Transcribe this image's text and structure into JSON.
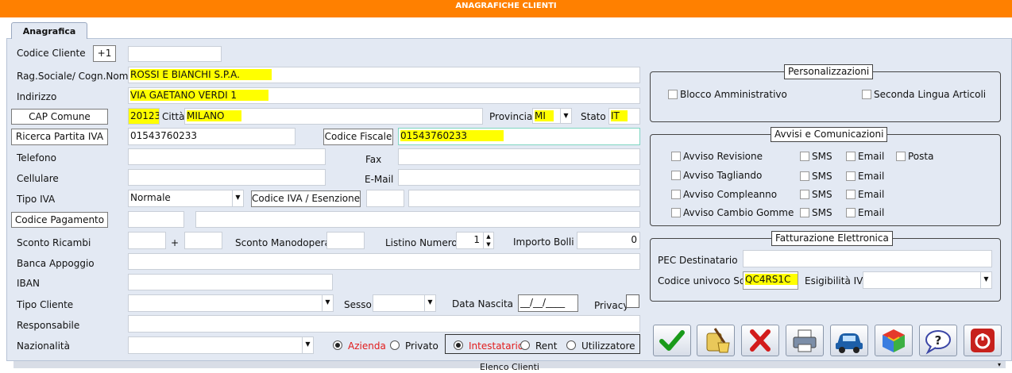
{
  "window": {
    "title": "ANAGRAFICHE CLIENTI"
  },
  "tab": {
    "label": "Anagrafica"
  },
  "left": {
    "codice_cliente_label": "Codice Cliente",
    "plus_button": "+1",
    "codice_cliente_value": "",
    "ragsociale_label": "Rag.Sociale/ Cogn.Nome",
    "ragsociale_value": "ROSSI E BIANCHI S.P.A.",
    "indirizzo_label": "Indirizzo",
    "indirizzo_value": "VIA GAETANO VERDI 1",
    "cap_button": "CAP Comune",
    "cap_value": "20123",
    "citta_label": "Città",
    "citta_value": "MILANO",
    "provincia_label": "Provincia",
    "provincia_value": "MI",
    "stato_label": "Stato",
    "stato_value": "IT",
    "piva_button": "Ricerca Partita IVA",
    "piva_value": "01543760233",
    "cf_button": "Codice Fiscale",
    "cf_value": "01543760233",
    "telefono_label": "Telefono",
    "fax_label": "Fax",
    "cellulare_label": "Cellulare",
    "email_label": "E-Mail",
    "tipoiva_label": "Tipo IVA",
    "tipoiva_value": "Normale",
    "codiva_button": "Codice IVA / Esenzione",
    "pagamento_button": "Codice Pagamento",
    "sconto_label": "Sconto Ricambi",
    "plus_sign": "+",
    "sconto_mano_label": "Sconto Manodopera",
    "listino_label": "Listino Numero",
    "listino_value": "1",
    "bolli_label": "Importo Bolli",
    "bolli_value": "0",
    "banca_label": "Banca Appoggio",
    "iban_label": "IBAN",
    "tipocliente_label": "Tipo Cliente",
    "sesso_label": "Sesso",
    "datanascita_label": "Data Nascita",
    "datanascita_value": "__/__/____",
    "privacy_label": "Privacy",
    "responsabile_label": "Responsabile",
    "nazionalita_label": "Nazionalità",
    "radio_azienda": "Azienda",
    "radio_privato": "Privato",
    "radio_intestatario": "Intestatario",
    "radio_rent": "Rent",
    "radio_utilizzatore": "Utilizzatore"
  },
  "personalizzazioni": {
    "title": "Personalizzazioni",
    "blocco": "Blocco Amministrativo",
    "seconda": "Seconda Lingua Articoli"
  },
  "avvisi": {
    "title": "Avvisi e  Comunicazioni",
    "rows": [
      {
        "label": "Avviso Revisione",
        "sms": "SMS",
        "email": "Email",
        "posta": "Posta"
      },
      {
        "label": "Avviso Tagliando",
        "sms": "SMS",
        "email": "Email"
      },
      {
        "label": "Avviso Compleanno",
        "sms": "SMS",
        "email": "Email"
      },
      {
        "label": "Avviso Cambio Gomme",
        "sms": "SMS",
        "email": "Email"
      }
    ]
  },
  "fatturazione": {
    "title": "Fatturazione Elettronica",
    "pec_label": "PEC Destinatario",
    "sdi_label": "Codice univoco SdI",
    "sdi_value": "QC4RS1C",
    "esigibilita_label": "Esigibilità IVA"
  },
  "toolbar": {
    "icons": [
      "check-icon",
      "broom-icon",
      "x-icon",
      "printer-icon",
      "car-icon",
      "cube-icon",
      "help-icon",
      "power-icon"
    ]
  },
  "bottom": {
    "label": "Elenco Clienti"
  },
  "colors": {
    "title_bar": "#ff8000",
    "highlight": "#ffff00",
    "panel": "#e3e9f3"
  }
}
